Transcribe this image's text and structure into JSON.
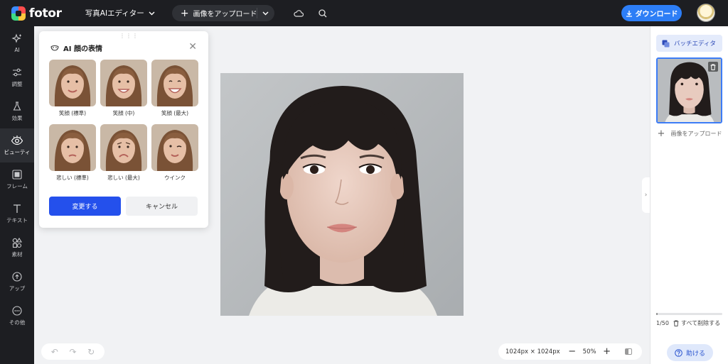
{
  "app": {
    "logo_text": "fotor"
  },
  "header": {
    "editor_menu": "写真AIエディター",
    "upload_label": "画像をアップロード",
    "download_label": "ダウンロード"
  },
  "rail": {
    "items": [
      {
        "label": "AI",
        "icon": "sparkle-icon"
      },
      {
        "label": "調整",
        "icon": "sliders-icon"
      },
      {
        "label": "効果",
        "icon": "flask-icon"
      },
      {
        "label": "ビューティ",
        "icon": "eye-icon"
      },
      {
        "label": "フレーム",
        "icon": "frame-icon"
      },
      {
        "label": "テキスト",
        "icon": "text-icon"
      },
      {
        "label": "素材",
        "icon": "elements-icon"
      },
      {
        "label": "アップ",
        "icon": "cloud-upload-icon"
      },
      {
        "label": "その他",
        "icon": "more-icon"
      }
    ],
    "active": "ビューティ"
  },
  "popup": {
    "title": "AI 顔の表情",
    "faces": [
      {
        "label": "笑顔 (標準)"
      },
      {
        "label": "笑顔 (中)"
      },
      {
        "label": "笑顔 (最大)"
      },
      {
        "label": "悲しい (標準)"
      },
      {
        "label": "悲しい (最大)"
      },
      {
        "label": "ウインク"
      }
    ],
    "apply_label": "変更する",
    "cancel_label": "キャンセル"
  },
  "zoom": {
    "dimensions": "1024px × 1024px",
    "percent": "50%"
  },
  "right_panel": {
    "batch_label": "バッチエディタ",
    "upload_label": "画像をアップロード",
    "count": "1/50",
    "count_fraction": 0.02,
    "delete_all_label": "すべて削除する",
    "help_label": "助ける"
  },
  "colors": {
    "primary": "#2450ec",
    "download": "#2d7ef6",
    "topbar": "#1d1e22"
  }
}
